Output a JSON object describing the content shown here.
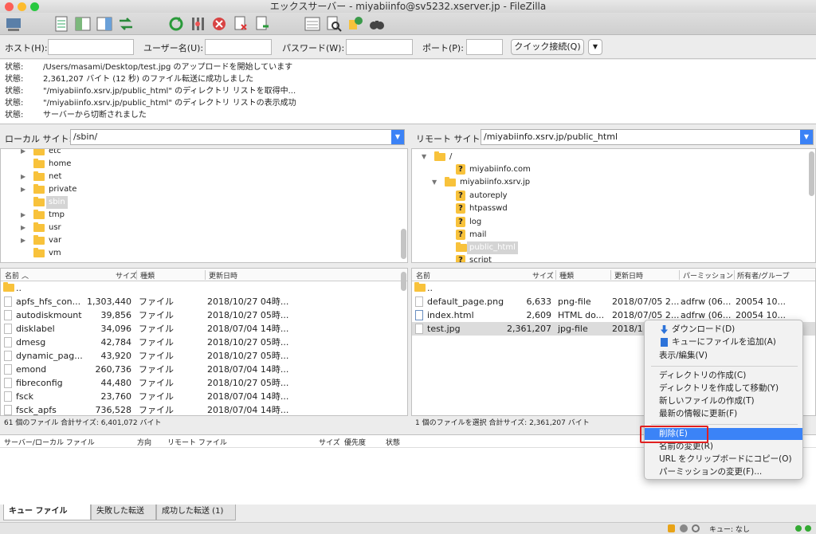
{
  "window": {
    "title": "エックスサーバー - miyabiinfo@sv5232.xserver.jp - FileZilla"
  },
  "quickconnect": {
    "host_label": "ホスト(H):",
    "user_label": "ユーザー名(U):",
    "pass_label": "パスワード(W):",
    "port_label": "ポート(P):",
    "button": "クイック接続(Q)"
  },
  "log": [
    {
      "k": "状態:",
      "v": "/Users/masami/Desktop/test.jpg のアップロードを開始しています"
    },
    {
      "k": "状態:",
      "v": "2,361,207 バイト (12 秒) のファイル転送に成功しました"
    },
    {
      "k": "状態:",
      "v": "\"/miyabiinfo.xsrv.jp/public_html\" のディレクトリ リストを取得中..."
    },
    {
      "k": "状態:",
      "v": "\"/miyabiinfo.xsrv.jp/public_html\" のディレクトリ リストの表示成功"
    },
    {
      "k": "状態:",
      "v": "サーバーから切断されました"
    }
  ],
  "local": {
    "site_label": "ローカル サイト:",
    "path": "/sbin/",
    "tree": [
      {
        "name": "etc",
        "arrow": "▶"
      },
      {
        "name": "home",
        "arrow": ""
      },
      {
        "name": "net",
        "arrow": "▶"
      },
      {
        "name": "private",
        "arrow": "▶"
      },
      {
        "name": "sbin",
        "arrow": "",
        "selected": true
      },
      {
        "name": "tmp",
        "arrow": "▶"
      },
      {
        "name": "usr",
        "arrow": "▶"
      },
      {
        "name": "var",
        "arrow": "▶"
      },
      {
        "name": "vm",
        "arrow": ""
      }
    ],
    "headers": {
      "name": "名前",
      "size": "サイズ",
      "type": "種類",
      "date": "更新日時"
    },
    "files": [
      {
        "name": "..",
        "size": "",
        "type": "",
        "date": "",
        "folder": true
      },
      {
        "name": "apfs_hfs_con...",
        "size": "1,303,440",
        "type": "ファイル",
        "date": "2018/10/27 04時..."
      },
      {
        "name": "autodiskmount",
        "size": "39,856",
        "type": "ファイル",
        "date": "2018/10/27 05時..."
      },
      {
        "name": "disklabel",
        "size": "34,096",
        "type": "ファイル",
        "date": "2018/07/04 14時..."
      },
      {
        "name": "dmesg",
        "size": "42,784",
        "type": "ファイル",
        "date": "2018/10/27 05時..."
      },
      {
        "name": "dynamic_pag...",
        "size": "43,920",
        "type": "ファイル",
        "date": "2018/10/27 05時..."
      },
      {
        "name": "emond",
        "size": "260,736",
        "type": "ファイル",
        "date": "2018/07/04 14時..."
      },
      {
        "name": "fibreconfig",
        "size": "44,480",
        "type": "ファイル",
        "date": "2018/10/27 05時..."
      },
      {
        "name": "fsck",
        "size": "23,760",
        "type": "ファイル",
        "date": "2018/07/04 14時..."
      },
      {
        "name": "fsck_apfs",
        "size": "736,528",
        "type": "ファイル",
        "date": "2018/07/04 14時..."
      }
    ],
    "status": "61 個のファイル 合計サイズ: 6,401,072 バイト"
  },
  "remote": {
    "site_label": "リモート サイト:",
    "path": "/miyabiinfo.xsrv.jp/public_html",
    "tree": [
      {
        "name": "/",
        "level": 0,
        "arrow": "▼",
        "icon": "folder"
      },
      {
        "name": "miyabiinfo.com",
        "level": 1,
        "arrow": "",
        "icon": "q"
      },
      {
        "name": "miyabiinfo.xsrv.jp",
        "level": 1,
        "arrow": "▼",
        "icon": "folder"
      },
      {
        "name": "autoreply",
        "level": 2,
        "arrow": "",
        "icon": "q"
      },
      {
        "name": "htpasswd",
        "level": 2,
        "arrow": "",
        "icon": "q"
      },
      {
        "name": "log",
        "level": 2,
        "arrow": "",
        "icon": "q"
      },
      {
        "name": "mail",
        "level": 2,
        "arrow": "",
        "icon": "q"
      },
      {
        "name": "public_html",
        "level": 2,
        "arrow": "",
        "icon": "folder",
        "selected": true
      },
      {
        "name": "script",
        "level": 2,
        "arrow": "",
        "icon": "q"
      }
    ],
    "headers": {
      "name": "名前",
      "size": "サイズ",
      "type": "種類",
      "date": "更新日時",
      "perm": "パーミッション",
      "owner": "所有者/グループ"
    },
    "files": [
      {
        "name": "..",
        "size": "",
        "type": "",
        "date": "",
        "perm": "",
        "owner": "",
        "folder": true
      },
      {
        "name": "default_page.png",
        "size": "6,633",
        "type": "png-file",
        "date": "2018/07/05 2...",
        "perm": "adfrw (06...",
        "owner": "20054 10..."
      },
      {
        "name": "index.html",
        "size": "2,609",
        "type": "HTML do...",
        "date": "2018/07/05 2...",
        "perm": "adfrw (06...",
        "owner": "20054 10..."
      },
      {
        "name": "test.jpg",
        "size": "2,361,207",
        "type": "jpg-file",
        "date": "2018/11,",
        "perm": "",
        "owner": "",
        "selected": true
      }
    ],
    "status": "1 個のファイルを選択 合計サイズ: 2,361,207 バイト"
  },
  "queue": {
    "headers": {
      "server": "サーバー/ローカル ファイル",
      "dir": "方向",
      "remote": "リモート ファイル",
      "size": "サイズ",
      "prio": "優先度",
      "status": "状態"
    },
    "tabs": [
      "キュー ファイル",
      "失敗した転送",
      "成功した転送 (1)"
    ],
    "status": "キュー: なし"
  },
  "context_menu": {
    "group1": [
      "ダウンロード(D)",
      "キューにファイルを追加(A)",
      "表示/編集(V)"
    ],
    "group2": [
      "ディレクトリの作成(C)",
      "ディレクトリを作成して移動(Y)",
      "新しいファイルの作成(T)",
      "最新の情報に更新(F)"
    ],
    "group3": [
      "削除(E)",
      "名前の変更(R)",
      "URL をクリップボードにコピー(O)",
      "パーミッションの変更(F)..."
    ]
  }
}
